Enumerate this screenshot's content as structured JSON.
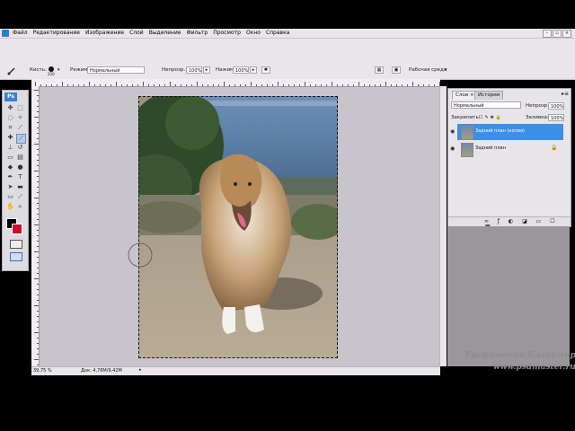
{
  "menu": {
    "items": [
      "Файл",
      "Редактирование",
      "Изображение",
      "Слой",
      "Выделение",
      "Фильтр",
      "Просмотр",
      "Окно",
      "Справка"
    ]
  },
  "options": {
    "brush_label": "Кисть:",
    "brush_size": "250",
    "mode_label": "Режим:",
    "mode_value": "Нормальный",
    "opacity_label": "Непрозр.:",
    "opacity_value": "100%",
    "pressure_label": "Нажим:",
    "pressure_value": "100%",
    "workspace_label": "Рабочая среда"
  },
  "toolbox": {
    "logo": "Ps"
  },
  "status": {
    "zoom": "39,75 %",
    "doc_size": "Док: 4,76M/9,42M"
  },
  "layers_panel": {
    "tabs": [
      "Слои",
      "История"
    ],
    "blend_mode": "Нормальный",
    "opacity_label": "Непрозр.:",
    "opacity_value": "100%",
    "lock_label": "Закрепить:",
    "fill_label": "Заливка:",
    "fill_value": "100%",
    "layers": [
      {
        "name": "Задний план (копия)",
        "selected": true
      },
      {
        "name": "Задний план",
        "selected": false
      }
    ]
  },
  "watermark": {
    "line1": "Трофименко Владимир",
    "line2": "www.psdmaster.ru"
  },
  "colors": {
    "chrome": "#e9e5ea",
    "workspace": "#c8c4cc",
    "selected_layer": "#3d8ee6",
    "foreground": "#000000",
    "background_swatch": "#c8102e"
  }
}
